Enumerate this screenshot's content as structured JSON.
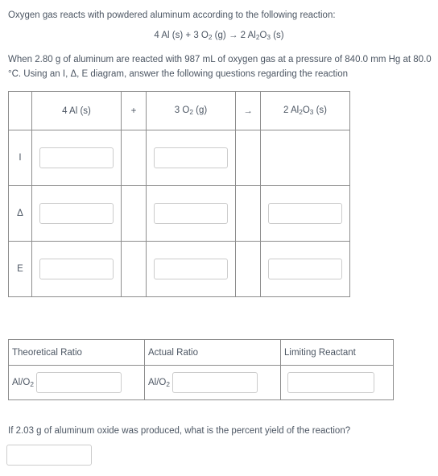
{
  "problem": {
    "intro": "Oxygen gas reacts with powdered aluminum according to the following reaction:",
    "conditions": "When 2.80 g of aluminum are reacted with 987 mL of oxygen gas at a pressure of 840.0 mm Hg at 80.0 °C. Using an I, Δ, E diagram, answer the following questions regarding the reaction",
    "yield_question": "If 2.03 g of aluminum oxide was produced, what is the percent yield of the reaction?"
  },
  "equation": {
    "reactant1_coeff": "4 ",
    "reactant1_formula": "Al",
    "reactant1_state": " (s)",
    "operator_plus": "+",
    "reactant2_coeff": "3 O",
    "reactant2_sub": "2",
    "reactant2_state": " (g)",
    "operator_arrow": "→",
    "product_coeff": "2 Al",
    "product_sub1": "2",
    "product_mid": "O",
    "product_sub2": "3",
    "product_state": " (s)"
  },
  "ice_table": {
    "header": {
      "corner": "",
      "reactant1": {
        "coeff": "4 Al",
        "state": " (s)"
      },
      "plus": "+",
      "reactant2": {
        "coeff": "3 O",
        "sub": "2",
        "state": " (g)"
      },
      "arrow": "→",
      "product": {
        "coeff": "2 Al",
        "sub1": "2",
        "mid": "O",
        "sub2": "3",
        "state": " (s)"
      }
    },
    "rows": [
      {
        "label": "I",
        "reactant1_value": "",
        "reactant2_value": "",
        "product_value": null
      },
      {
        "label": "Δ",
        "reactant1_value": "",
        "reactant2_value": "",
        "product_value": ""
      },
      {
        "label": "E",
        "reactant1_value": "",
        "reactant2_value": "",
        "product_value": ""
      }
    ]
  },
  "ratio_table": {
    "headers": [
      "Theoretical Ratio",
      "Actual Ratio",
      "Limiting Reactant"
    ],
    "theoretical": {
      "label_main": "Al/O",
      "label_sub": "2",
      "value": ""
    },
    "actual": {
      "label_main": "Al/O",
      "label_sub": "2",
      "value": ""
    },
    "limiting": {
      "value": ""
    }
  },
  "yield_answer": {
    "value": ""
  },
  "colors": {
    "text": "#4c5663",
    "table_border_outer": "#3d3d3d",
    "table_border_inner": "#8d8d8d",
    "input_border": "#cccccc",
    "plus_symbol": "#a99a86",
    "background": "#ffffff"
  }
}
